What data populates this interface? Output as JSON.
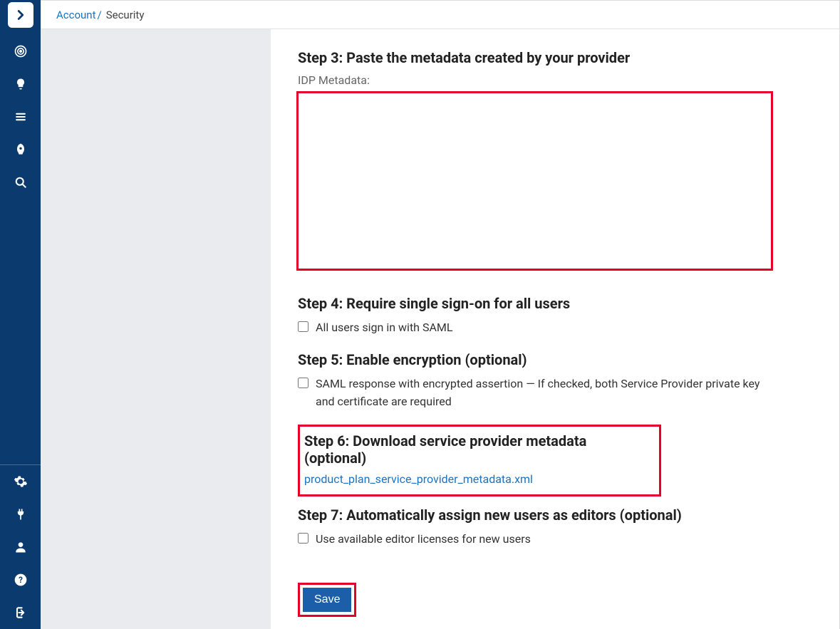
{
  "breadcrumb": {
    "parent": "Account",
    "separator": "/",
    "current": "Security"
  },
  "nav": {
    "top_icons": [
      "logo",
      "target",
      "lightbulb",
      "menu",
      "rocket",
      "search"
    ],
    "bottom_icons": [
      "gear",
      "plug",
      "user",
      "help",
      "logout"
    ]
  },
  "steps": {
    "s3": {
      "title": "Step 3: Paste the metadata created by your provider",
      "field_label": "IDP Metadata:",
      "value": ""
    },
    "s4": {
      "title": "Step 4: Require single sign-on for all users",
      "checkbox_label": "All users sign in with SAML",
      "checked": false
    },
    "s5": {
      "title": "Step 5: Enable encryption (optional)",
      "checkbox_label": "SAML response with encrypted assertion — If checked, both Service Provider private key and certificate are required",
      "checked": false
    },
    "s6": {
      "title": "Step 6: Download service provider metadata (optional)",
      "link_text": "product_plan_service_provider_metadata.xml"
    },
    "s7": {
      "title": "Step 7: Automatically assign new users as editors (optional)",
      "checkbox_label": "Use available editor licenses for new users",
      "checked": false
    }
  },
  "actions": {
    "save_label": "Save"
  },
  "colors": {
    "nav_bg": "#0b3a6f",
    "link": "#1a73c2",
    "highlight": "#e4002b"
  }
}
